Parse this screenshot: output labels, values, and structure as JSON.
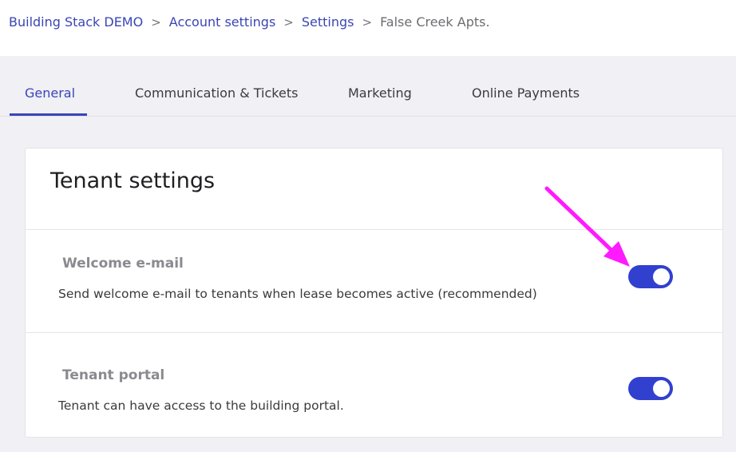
{
  "breadcrumb": {
    "items": [
      "Building Stack DEMO",
      "Account settings",
      "Settings"
    ],
    "current": "False Creek Apts.",
    "separator": ">"
  },
  "tabs": [
    {
      "label": "General",
      "active": true
    },
    {
      "label": "Communication & Tickets",
      "active": false
    },
    {
      "label": "Marketing",
      "active": false
    },
    {
      "label": "Online Payments",
      "active": false
    }
  ],
  "card": {
    "title": "Tenant settings",
    "settings": [
      {
        "title": "Welcome e-mail",
        "description": "Send welcome e-mail to tenants when lease becomes active (recommended)",
        "enabled": true
      },
      {
        "title": "Tenant portal",
        "description": "Tenant can have access to the building portal.",
        "enabled": true
      }
    ]
  },
  "colors": {
    "accent": "#3a45b5",
    "toggle_on": "#3140cf",
    "annotation_arrow": "#ff1aff",
    "background": "#f0f0f5"
  }
}
